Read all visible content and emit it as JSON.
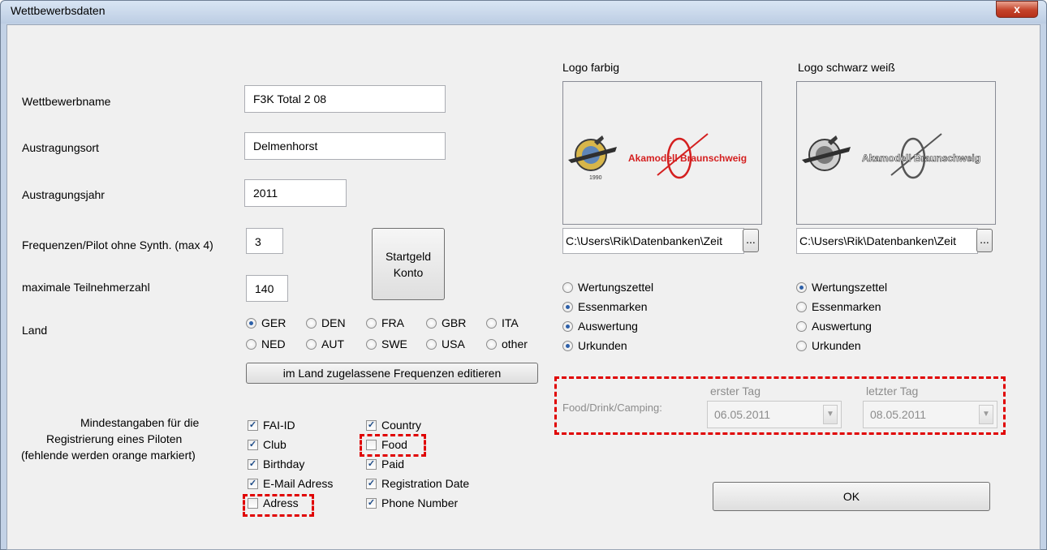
{
  "window": {
    "title": "Wettbewerbsdaten",
    "close_glyph": "x"
  },
  "form": {
    "name_label": "Wettbewerbname",
    "name_value": "F3K Total 2 08",
    "place_label": "Austragungsort",
    "place_value": "Delmenhorst",
    "year_label": "Austragungsjahr",
    "year_value": "2011",
    "freq_label": "Frequenzen/Pilot ohne Synth.  (max 4)",
    "freq_value": "3",
    "max_label": "maximale Teilnehmerzahl",
    "max_value": "140",
    "startgeld_label": "Startgeld\nKonto",
    "land_label": "Land",
    "countries": [
      {
        "label": "GER",
        "selected": true
      },
      {
        "label": "DEN",
        "selected": false
      },
      {
        "label": "FRA",
        "selected": false
      },
      {
        "label": "GBR",
        "selected": false
      },
      {
        "label": "ITA",
        "selected": false
      },
      {
        "label": "NED",
        "selected": false
      },
      {
        "label": "AUT",
        "selected": false
      },
      {
        "label": "SWE",
        "selected": false
      },
      {
        "label": "USA",
        "selected": false
      },
      {
        "label": "other",
        "selected": false
      }
    ],
    "freq_edit_button": "im Land zugelassene Frequenzen editieren"
  },
  "registration": {
    "label_line1": "Mindestangaben für die",
    "label_line2": "Registrierung eines Piloten",
    "label_line3": "(fehlende werden orange markiert)",
    "left": [
      {
        "label": "FAI-ID",
        "checked": true
      },
      {
        "label": "Club",
        "checked": true
      },
      {
        "label": "Birthday",
        "checked": true
      },
      {
        "label": "E-Mail Adress",
        "checked": true
      },
      {
        "label": "Adress",
        "checked": false
      }
    ],
    "right": [
      {
        "label": "Country",
        "checked": true
      },
      {
        "label": "Food",
        "checked": false
      },
      {
        "label": "Paid",
        "checked": true
      },
      {
        "label": "Registration Date",
        "checked": true
      },
      {
        "label": "Phone Number",
        "checked": true
      }
    ]
  },
  "logos": {
    "color_title": "Logo farbig",
    "bw_title": "Logo schwarz weiß",
    "color_path": "C:\\Users\\Rik\\Datenbanken\\Zeit",
    "bw_path": "C:\\Users\\Rik\\Datenbanken\\Zeit",
    "browse": "...",
    "logo_text": "Akamodell Braunschweig",
    "seal_text": "1990",
    "color_options": [
      {
        "label": "Wertungszettel",
        "selected": false
      },
      {
        "label": "Essenmarken",
        "selected": true
      },
      {
        "label": "Auswertung",
        "selected": true
      },
      {
        "label": "Urkunden",
        "selected": true
      }
    ],
    "bw_options": [
      {
        "label": "Wertungszettel",
        "selected": true
      },
      {
        "label": "Essenmarken",
        "selected": false
      },
      {
        "label": "Auswertung",
        "selected": false
      },
      {
        "label": "Urkunden",
        "selected": false
      }
    ]
  },
  "food": {
    "label": "Food/Drink/Camping:",
    "first_day_label": "erster Tag",
    "first_day_value": "06.05.2011",
    "last_day_label": "letzter Tag",
    "last_day_value": "08.05.2011"
  },
  "ok_button": "OK",
  "colors": {
    "highlight": "#e00000",
    "accent": "#2c5fa8",
    "logo_red": "#d41f1f"
  }
}
